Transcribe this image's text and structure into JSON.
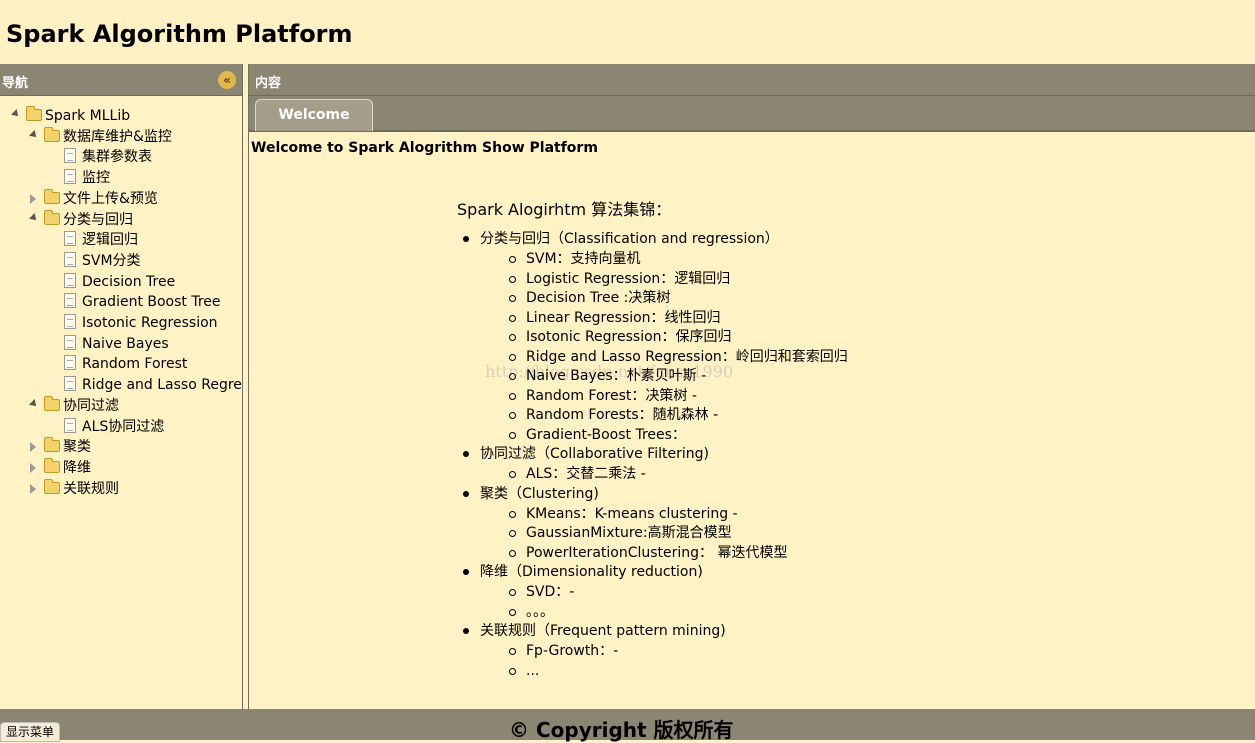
{
  "app": {
    "title": "Spark Algorithm Platform"
  },
  "west": {
    "header": "导航",
    "collapse_icon": "double-chevron-left-icon",
    "tree": [
      {
        "label": "Spark MLLib",
        "type": "folder",
        "level": 0,
        "expanded": true
      },
      {
        "label": "数据库维护&监控",
        "type": "folder",
        "level": 1,
        "expanded": true
      },
      {
        "label": "集群参数表",
        "type": "file",
        "level": 2
      },
      {
        "label": "监控",
        "type": "file",
        "level": 2
      },
      {
        "label": "文件上传&预览",
        "type": "folder",
        "level": 1,
        "expanded": false
      },
      {
        "label": "分类与回归",
        "type": "folder",
        "level": 1,
        "expanded": true
      },
      {
        "label": "逻辑回归",
        "type": "file",
        "level": 2
      },
      {
        "label": "SVM分类",
        "type": "file",
        "level": 2
      },
      {
        "label": "Decision Tree",
        "type": "file",
        "level": 2
      },
      {
        "label": "Gradient Boost Tree",
        "type": "file",
        "level": 2
      },
      {
        "label": "Isotonic Regression",
        "type": "file",
        "level": 2
      },
      {
        "label": "Naive Bayes",
        "type": "file",
        "level": 2
      },
      {
        "label": "Random Forest",
        "type": "file",
        "level": 2
      },
      {
        "label": "Ridge and Lasso Regre",
        "type": "file",
        "level": 2
      },
      {
        "label": "协同过滤",
        "type": "folder",
        "level": 1,
        "expanded": true
      },
      {
        "label": "ALS协同过滤",
        "type": "file",
        "level": 2
      },
      {
        "label": "聚类",
        "type": "folder",
        "level": 1,
        "expanded": false
      },
      {
        "label": "降维",
        "type": "folder",
        "level": 1,
        "expanded": false
      },
      {
        "label": "关联规则",
        "type": "folder",
        "level": 1,
        "expanded": false
      }
    ]
  },
  "center": {
    "header": "内容",
    "tabs": [
      {
        "label": "Welcome",
        "selected": true
      }
    ],
    "welcome": "Welcome to Spark Alogrithm Show Platform",
    "content_title": "Spark Alogirhtm 算法集锦：",
    "watermark": "http://blog.csdn.net/fansy1990",
    "sections": [
      {
        "label": "分类与回归（Classification and regression）",
        "items": [
          "SVM：支持向量机",
          "Logistic Regression：逻辑回归",
          "Decision Tree :决策树",
          "Linear Regression：线性回归",
          "Isotonic Regression：保序回归",
          "Ridge and Lasso Regression：岭回归和套索回归",
          "Naive Bayes：朴素贝叶斯 -",
          "Random Forest：决策树 -",
          "Random Forests：随机森林 -",
          "Gradient-Boost Trees："
        ]
      },
      {
        "label": "协同过滤（Collaborative Filtering)",
        "items": [
          "ALS：交替二乘法 -"
        ]
      },
      {
        "label": "聚类（Clustering)",
        "items": [
          "KMeans：K-means clustering -",
          "GaussianMixture:高斯混合模型",
          "PowerIterationClustering：  幂迭代模型"
        ]
      },
      {
        "label": "降维（Dimensionality reduction)",
        "items": [
          "SVD：-",
          "。。。"
        ]
      },
      {
        "label": "关联规则（Frequent pattern mining)",
        "items": [
          "Fp-Growth：-",
          "..."
        ]
      }
    ]
  },
  "footer": {
    "copyright": "© Copyright 版权所有",
    "show_menu": "显示菜单"
  }
}
